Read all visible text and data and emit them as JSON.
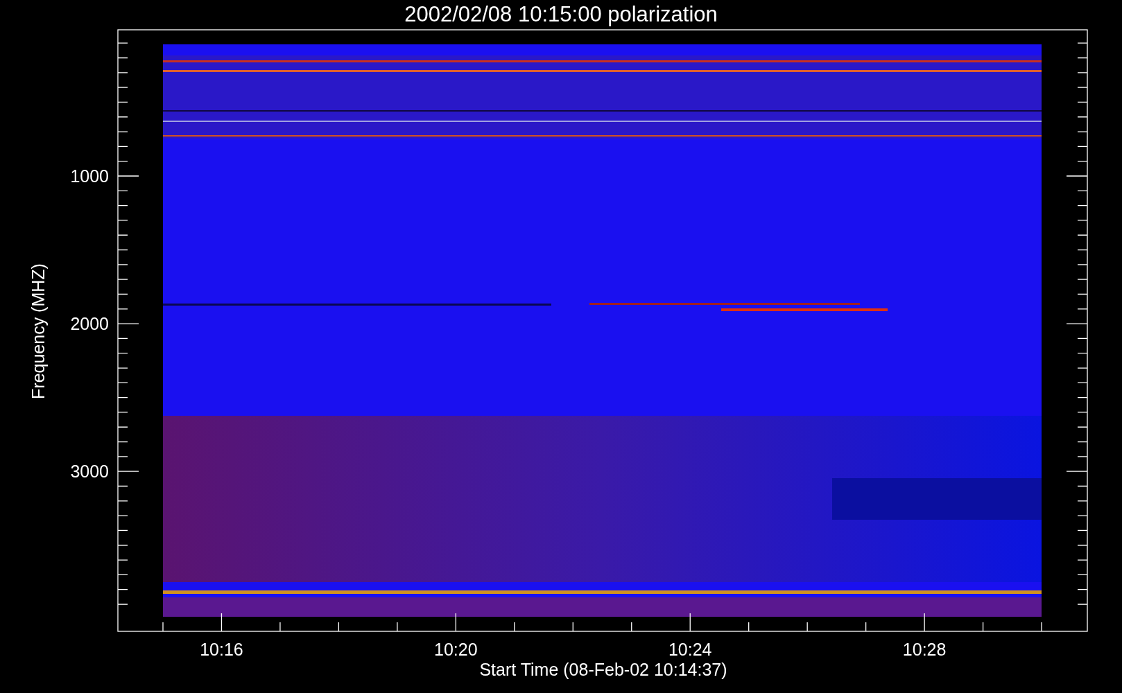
{
  "title": "2002/02/08 10:15:00 polarization",
  "y_axis": {
    "label": "Frequency (MHZ)",
    "ticks": [
      {
        "label": "1000"
      },
      {
        "label": "2000"
      },
      {
        "label": "3000"
      }
    ]
  },
  "x_axis": {
    "label": "Start Time (08-Feb-02 10:14:37)",
    "ticks": [
      {
        "label": "10:16"
      },
      {
        "label": "10:20"
      },
      {
        "label": "10:24"
      },
      {
        "label": "10:28"
      }
    ]
  }
}
